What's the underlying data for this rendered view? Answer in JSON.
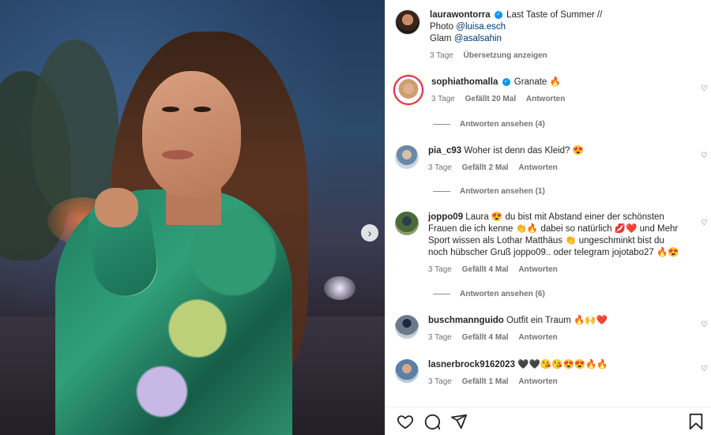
{
  "post": {
    "author": "laurawontorra",
    "caption_text": "Last Taste of Summer //",
    "photo_label": "Photo",
    "photo_link": "@luisa.esch",
    "glam_label": "Glam",
    "glam_link": "@asalsahin",
    "age": "3 Tage",
    "translate": "Übersetzung anzeigen"
  },
  "comments": [
    {
      "user": "sophiathomalla",
      "verified": true,
      "text": "Granate",
      "emoji": "🔥",
      "age": "3 Tage",
      "likes": "Gefällt 20 Mal",
      "reply": "Antworten",
      "view_replies": "Antworten ansehen (4)"
    },
    {
      "user": "pia_c93",
      "text": "Woher ist denn das Kleid?",
      "emoji": "😍",
      "age": "3 Tage",
      "likes": "Gefällt 2 Mal",
      "reply": "Antworten",
      "view_replies": "Antworten ansehen (1)"
    },
    {
      "user": "joppo09",
      "text_1": "Laura",
      "emoji_1": "😍",
      "text_2": "du bist mit Abstand einer der schönsten Frauen die ich kenne",
      "emoji_2": "👏🔥",
      "text_3": "dabei so natürlich",
      "emoji_3": "💋❤️",
      "text_4": "und Mehr Sport wissen als Lothar Matthäus",
      "emoji_4": "👏",
      "text_5": "ungeschminkt bist du noch hübscher Gruß joppo09.. oder telegram jojotabo27",
      "emoji_5": "🔥😍",
      "age": "3 Tage",
      "likes": "Gefällt 4 Mal",
      "reply": "Antworten",
      "view_replies": "Antworten ansehen (6)"
    },
    {
      "user": "buschmannguido",
      "text": "Outfit ein Traum",
      "emoji": "🔥🙌❤️",
      "age": "3 Tage",
      "likes": "Gefällt 4 Mal",
      "reply": "Antworten"
    },
    {
      "user": "lasnerbrock9162023",
      "emoji": "🖤🖤😘😘😍😍🔥🔥",
      "age": "3 Tage",
      "likes": "Gefällt 1 Mal",
      "reply": "Antworten"
    }
  ],
  "icons": {
    "like": "heart-icon",
    "comment": "comment-icon",
    "share": "share-icon",
    "save": "bookmark-icon",
    "next": "chevron-right-icon"
  },
  "colors": {
    "verified": "#0095f6",
    "link": "#00376b",
    "muted": "#737373"
  }
}
